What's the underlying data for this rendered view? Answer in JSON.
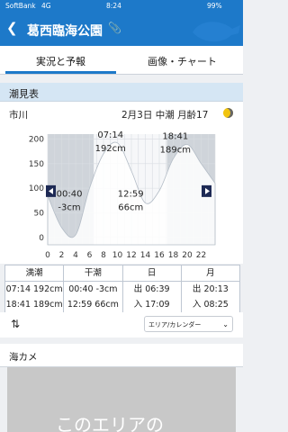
{
  "status": {
    "carrier": "SoftBank",
    "network": "4G",
    "time": "8:24",
    "battery": "99%"
  },
  "nav": {
    "back_icon": "chevron-left-icon",
    "title": "葛西臨海公園",
    "clip_icon": "paperclip-icon"
  },
  "tabs": [
    {
      "label": "実況と予報",
      "active": true
    },
    {
      "label": "画像・チャート",
      "active": false
    }
  ],
  "section": {
    "title": "潮見表"
  },
  "tide": {
    "location": "市川",
    "date": "2月3日",
    "tide_type": "中潮",
    "moon_age_label": "月齢17",
    "moon_icon": "moon-phase-icon"
  },
  "chart_data": {
    "type": "area",
    "x": [
      0,
      2,
      4,
      6,
      8,
      10,
      12,
      14,
      16,
      18,
      20,
      22,
      24
    ],
    "xticks": [
      0,
      2,
      4,
      6,
      8,
      10,
      12,
      14,
      16,
      18,
      20,
      22
    ],
    "y": [
      85,
      20,
      5,
      100,
      170,
      192,
      135,
      70,
      95,
      160,
      189,
      150,
      110
    ],
    "ylim": [
      -15,
      210
    ],
    "yticks": [
      0,
      50,
      100,
      150,
      200
    ],
    "annotations": [
      {
        "time": "07:14",
        "height": "192cm"
      },
      {
        "time": "18:41",
        "height": "189cm"
      },
      {
        "time": "00:40",
        "height": "-3cm"
      },
      {
        "time": "12:59",
        "height": "66cm"
      }
    ],
    "night_ranges": [
      [
        0,
        6.6
      ],
      [
        17.1,
        24
      ]
    ],
    "prev_icon": "arrow-left-icon",
    "next_icon": "arrow-right-icon"
  },
  "table": {
    "headers": [
      "満潮",
      "干潮",
      "日",
      "月"
    ],
    "rows": [
      [
        "07:14 192cm",
        "00:40 -3cm",
        "出 06:39",
        "出 20:13"
      ],
      [
        "18:41 189cm",
        "12:59 66cm",
        "入 17:09",
        "入 08:25"
      ]
    ]
  },
  "tools": {
    "swap_icon": "swap-icon",
    "select_label": "エリア/カレンダー",
    "chevron_icon": "chevron-down-icon"
  },
  "camera": {
    "title": "海カメ",
    "overlay_text": "このエリアの"
  }
}
